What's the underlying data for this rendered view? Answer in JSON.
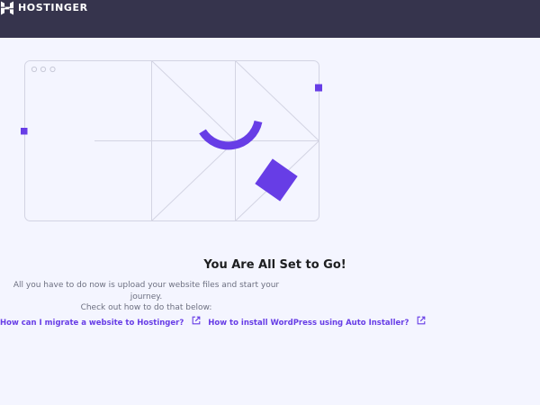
{
  "header": {
    "brand": "HOSTINGER",
    "logo_icon": "hostinger-logo-icon",
    "background": "#36344d"
  },
  "main": {
    "title": "You Are All Set to Go!",
    "description_line1": "All you have to do now is upload your website files and start your journey.",
    "description_line2": "Check out how to do that below:",
    "links": [
      {
        "label": "How can I migrate a website to Hostinger?",
        "icon": "external-link-icon"
      },
      {
        "label": "How to install WordPress using Auto Installer?",
        "icon": "external-link-icon"
      }
    ]
  },
  "colors": {
    "accent": "#673de6",
    "page_background": "#f4f5ff",
    "title_text": "#1d1e20",
    "body_text": "#6d7081"
  }
}
